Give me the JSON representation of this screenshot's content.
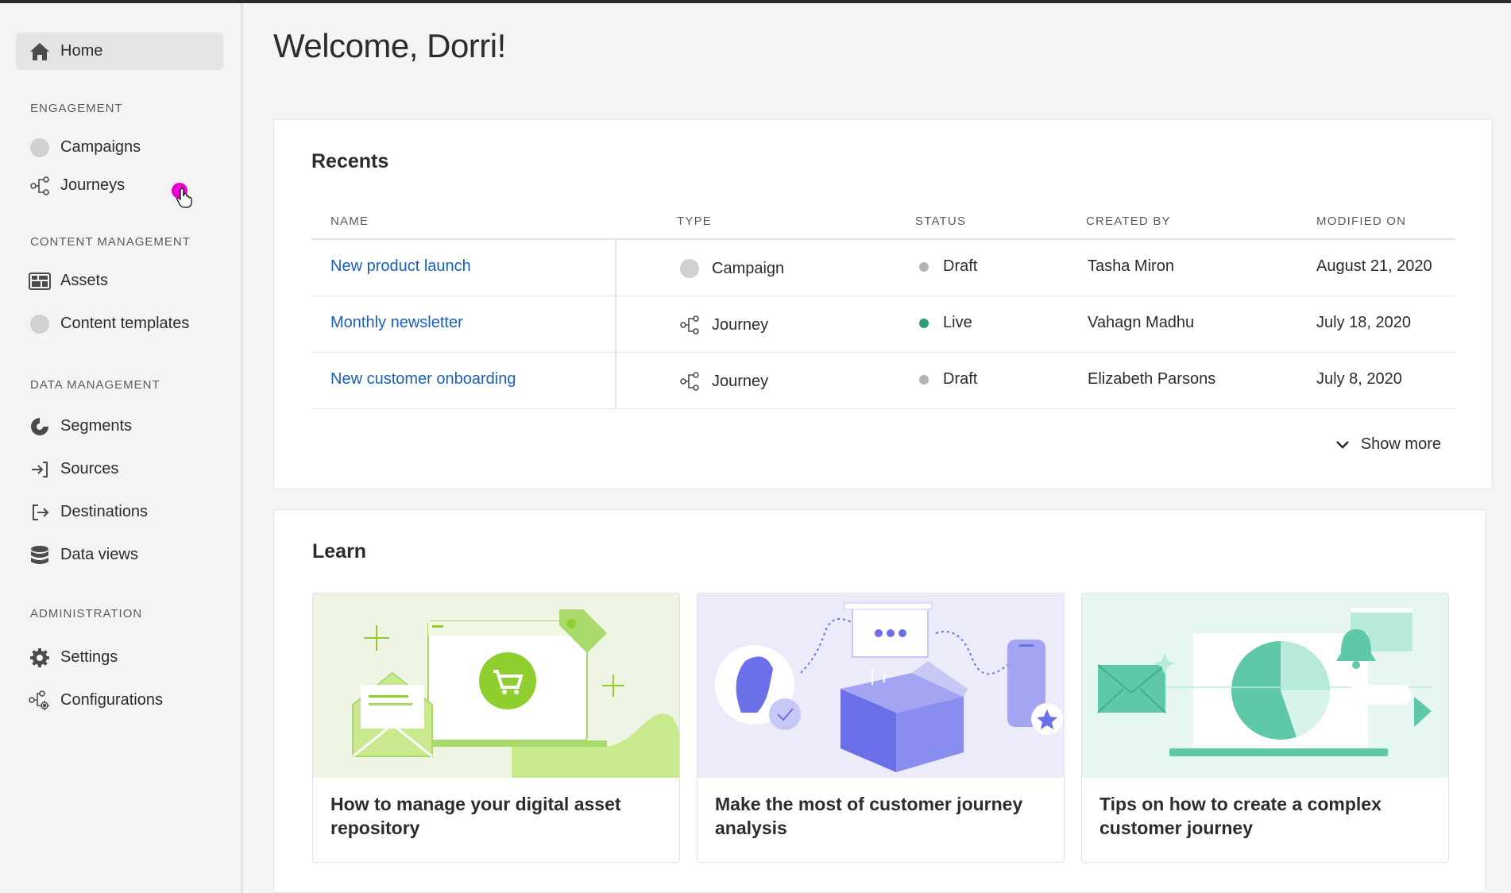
{
  "sidebar": {
    "home": "Home",
    "sections": {
      "engagement": "ENGAGEMENT",
      "content": "CONTENT MANAGEMENT",
      "data": "DATA MANAGEMENT",
      "admin": "ADMINISTRATION"
    },
    "items": {
      "campaigns": "Campaigns",
      "journeys": "Journeys",
      "assets": "Assets",
      "content_templates": "Content templates",
      "segments": "Segments",
      "sources": "Sources",
      "destinations": "Destinations",
      "data_views": "Data views",
      "settings": "Settings",
      "configurations": "Configurations"
    }
  },
  "main": {
    "welcome": "Welcome, Dorri!"
  },
  "recents": {
    "title": "Recents",
    "columns": [
      "NAME",
      "TYPE",
      "STATUS",
      "CREATED BY",
      "MODIFIED ON"
    ],
    "rows": [
      {
        "name": "New product launch",
        "type": "Campaign",
        "type_icon": "campaign-icon",
        "status": "Draft",
        "status_color": "#b3b3b3",
        "created_by": "Tasha Miron",
        "modified_on": "August 21, 2020"
      },
      {
        "name": "Monthly newsletter",
        "type": "Journey",
        "type_icon": "journey-icon",
        "status": "Live",
        "status_color": "#2d9d78",
        "created_by": "Vahagn Madhu",
        "modified_on": "July 18, 2020"
      },
      {
        "name": "New customer onboarding",
        "type": "Journey",
        "type_icon": "journey-icon",
        "status": "Draft",
        "status_color": "#b3b3b3",
        "created_by": "Elizabeth Parsons",
        "modified_on": "July 8, 2020"
      }
    ],
    "show_more": "Show more"
  },
  "learn": {
    "title": "Learn",
    "tiles": [
      {
        "caption": "How to manage your digital asset repository",
        "accent": "#8fce2f"
      },
      {
        "caption": "Make the most of customer journey analysis",
        "accent": "#6b6fe8"
      },
      {
        "caption": "Tips on how to create a complex customer journey",
        "accent": "#5ec8a8"
      }
    ]
  }
}
